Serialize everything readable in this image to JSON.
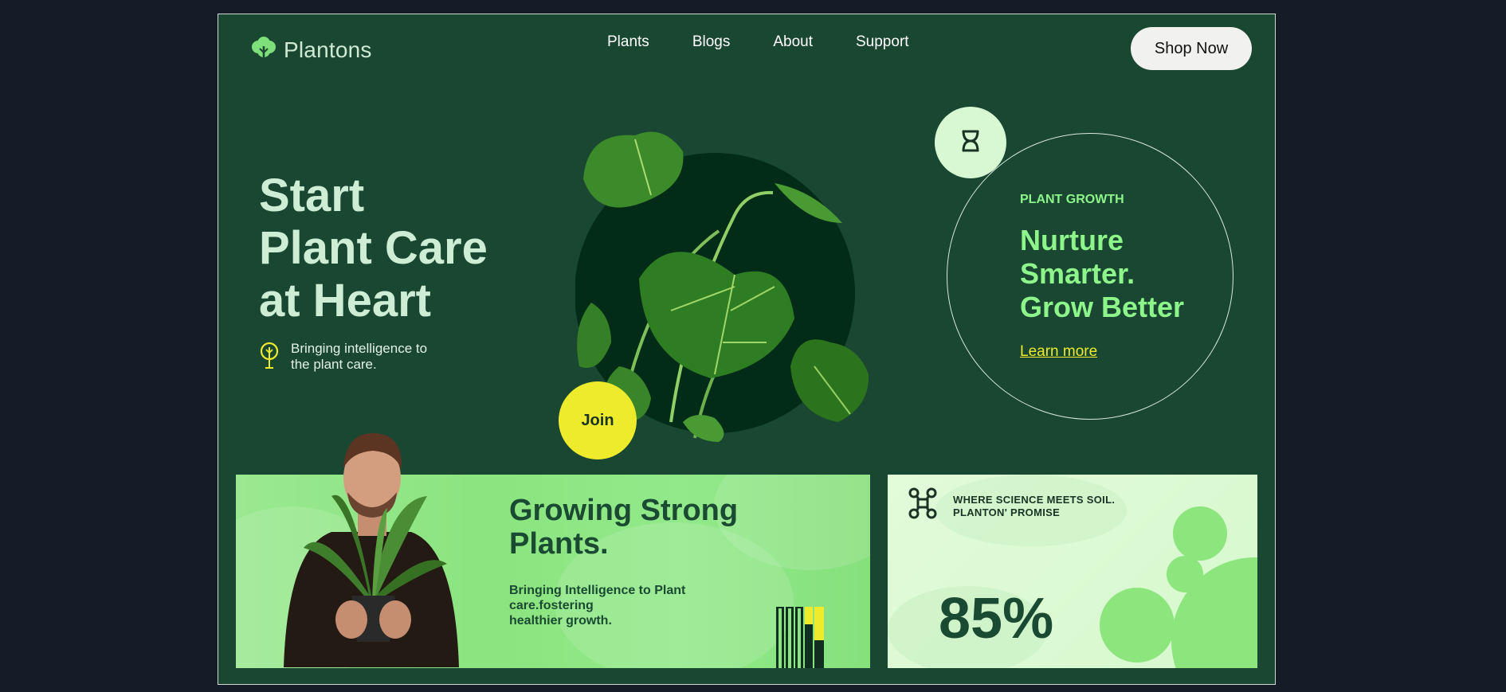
{
  "brand": {
    "name": "Plantons"
  },
  "nav": {
    "items": [
      "Plants",
      "Blogs",
      "About",
      "Support"
    ]
  },
  "header": {
    "cta_label": "Shop Now"
  },
  "hero": {
    "title_lines": [
      "Start",
      "Plant Care",
      "at Heart"
    ],
    "tagline_lines": [
      "Bringing intelligence to",
      "the plant care."
    ],
    "join_label": "Join"
  },
  "growth": {
    "label": "PLANT GROWTH",
    "title_lines": [
      "Nurture",
      "Smarter.",
      "Grow Better"
    ],
    "link_label": "Learn more"
  },
  "card_left": {
    "title_lines": [
      "Growing Strong",
      "Plants."
    ],
    "text_lines": [
      "Bringing Intelligence to Plant",
      "care.fostering",
      "healthier growth."
    ]
  },
  "card_right": {
    "heading_lines": [
      "WHERE SCIENCE MEETS SOIL.",
      "PLANTON' PROMISE"
    ],
    "stat": "85%"
  },
  "colors": {
    "background": "#194732",
    "accent_yellow": "#eeeb2d",
    "accent_green": "#8ef58a",
    "card_green": "#8be47f"
  },
  "icons": [
    "plant-logo-icon",
    "lightbulb-plant-icon",
    "dna-icon",
    "molecule-icon"
  ]
}
